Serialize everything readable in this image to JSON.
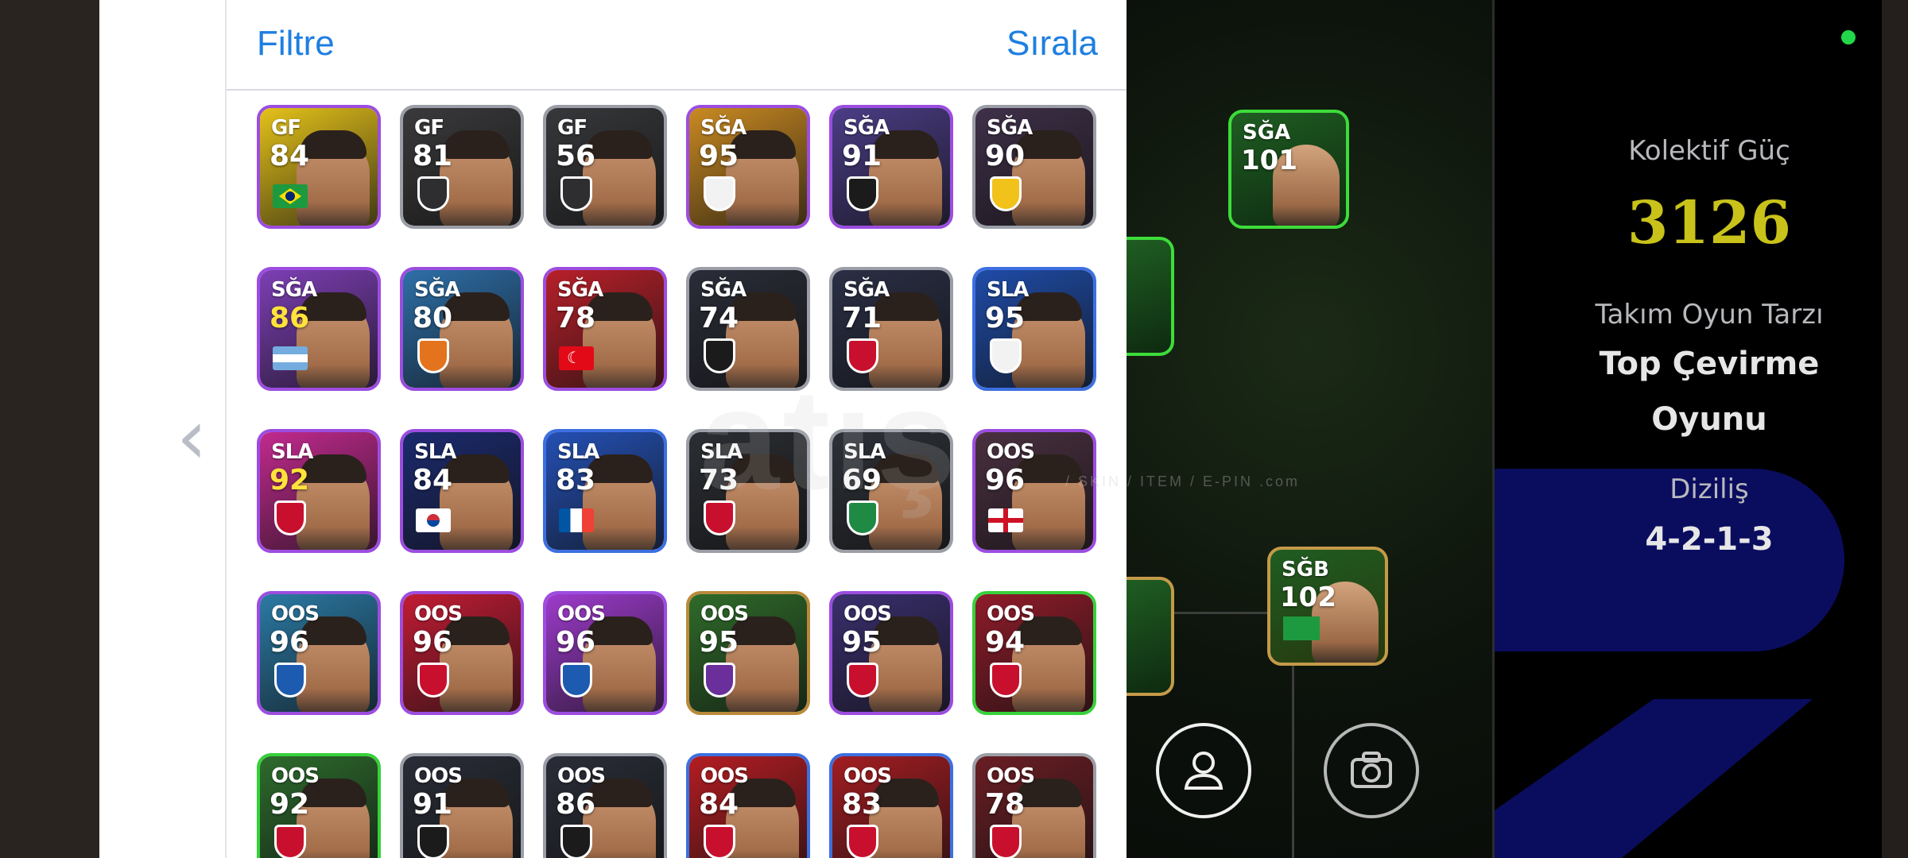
{
  "panel": {
    "filter_label": "Filtre",
    "sort_label": "Sırala"
  },
  "players": [
    {
      "pos": "GF",
      "rating": "84",
      "frame": "purple",
      "bg": "#e4c21a",
      "flag": "brazil"
    },
    {
      "pos": "GF",
      "rating": "81",
      "frame": "grey",
      "bg": "#3a3a3c",
      "flag": "shield"
    },
    {
      "pos": "GF",
      "rating": "56",
      "frame": "grey",
      "bg": "#37383b",
      "flag": "shield"
    },
    {
      "pos": "SĞA",
      "rating": "95",
      "frame": "purple",
      "bg": "#c98a22",
      "flag": "crest-white"
    },
    {
      "pos": "SĞA",
      "rating": "91",
      "frame": "purple",
      "bg": "#4b3d86",
      "flag": "crest-black"
    },
    {
      "pos": "SĞA",
      "rating": "90",
      "frame": "grey",
      "bg": "#3f3049",
      "flag": "crest-yellow"
    },
    {
      "pos": "SĞA",
      "rating": "86",
      "frame": "purple",
      "bg": "#7d3fb5",
      "flag": "argentina",
      "yellow": true
    },
    {
      "pos": "SĞA",
      "rating": "80",
      "frame": "purple",
      "bg": "#2e6fa8",
      "flag": "crest-orange"
    },
    {
      "pos": "SĞA",
      "rating": "78",
      "frame": "purple",
      "bg": "#b8202a",
      "flag": "turkey"
    },
    {
      "pos": "SĞA",
      "rating": "74",
      "frame": "grey",
      "bg": "#2a2d38",
      "flag": "crest-black"
    },
    {
      "pos": "SĞA",
      "rating": "71",
      "frame": "grey",
      "bg": "#2a2f45",
      "flag": "crest-red"
    },
    {
      "pos": "SLA",
      "rating": "95",
      "frame": "blue",
      "bg": "#1f4ca8",
      "flag": "crest-white"
    },
    {
      "pos": "SLA",
      "rating": "92",
      "frame": "purple",
      "bg": "#c22a8f",
      "flag": "crest-red",
      "yellow": true
    },
    {
      "pos": "SLA",
      "rating": "84",
      "frame": "purple",
      "bg": "#1c2a6e",
      "flag": "korea"
    },
    {
      "pos": "SLA",
      "rating": "83",
      "frame": "blue",
      "bg": "#2450b4",
      "flag": "france"
    },
    {
      "pos": "SLA",
      "rating": "73",
      "frame": "grey",
      "bg": "#2b2e33",
      "flag": "crest-red"
    },
    {
      "pos": "SLA",
      "rating": "69",
      "frame": "grey",
      "bg": "#2d3138",
      "flag": "crest-green"
    },
    {
      "pos": "OOS",
      "rating": "96",
      "frame": "purple",
      "bg": "#4a3040",
      "flag": "england"
    },
    {
      "pos": "OOS",
      "rating": "96",
      "frame": "purple",
      "bg": "#2b7aa5",
      "flag": "crest-blue"
    },
    {
      "pos": "OOS",
      "rating": "96",
      "frame": "purple",
      "bg": "#c21c34",
      "flag": "crest-red"
    },
    {
      "pos": "OOS",
      "rating": "96",
      "frame": "purple",
      "bg": "#9d3bcc",
      "flag": "crest-blue"
    },
    {
      "pos": "OOS",
      "rating": "95",
      "frame": "gold",
      "bg": "#2f6b2a",
      "flag": "crest-purple"
    },
    {
      "pos": "OOS",
      "rating": "95",
      "frame": "purple",
      "bg": "#3a2f6e",
      "flag": "crest-red"
    },
    {
      "pos": "OOS",
      "rating": "94",
      "frame": "green",
      "bg": "#8f1c2a",
      "flag": "crest-red"
    },
    {
      "pos": "OOS",
      "rating": "92",
      "frame": "green",
      "bg": "#2d6b2d",
      "flag": "crest-red"
    },
    {
      "pos": "OOS",
      "rating": "91",
      "frame": "grey",
      "bg": "#2a2d38",
      "flag": "crest-black"
    },
    {
      "pos": "OOS",
      "rating": "86",
      "frame": "grey",
      "bg": "#2a2d38",
      "flag": "crest-black"
    },
    {
      "pos": "OOS",
      "rating": "84",
      "frame": "blue",
      "bg": "#b31d22",
      "flag": "crest-red"
    },
    {
      "pos": "OOS",
      "rating": "83",
      "frame": "blue",
      "bg": "#a31d22",
      "flag": "crest-red"
    },
    {
      "pos": "OOS",
      "rating": "78",
      "frame": "grey",
      "bg": "#6a1e24",
      "flag": "crest-red"
    }
  ],
  "pitch": {
    "top_card": {
      "pos": "SĞA",
      "rating": "101"
    },
    "mid_card": {
      "pos": "SĞB",
      "rating": "102"
    }
  },
  "watermark": {
    "text": "atış",
    "subtext": "/ SKIN / ITEM / E-PIN  .com"
  },
  "team": {
    "collective_power_label": "Kolektif Güç",
    "collective_power_value": "3126",
    "playstyle_label": "Takım Oyun Tarzı",
    "playstyle_value_line1": "Top Çevirme",
    "playstyle_value_line2": "Oyunu",
    "formation_label": "Diziliş",
    "formation_value": "4-2-1-3"
  },
  "colors": {
    "accent_blue": "#1e7fe0",
    "power_yellow": "#c9c21a",
    "status_green": "#22d84a"
  }
}
